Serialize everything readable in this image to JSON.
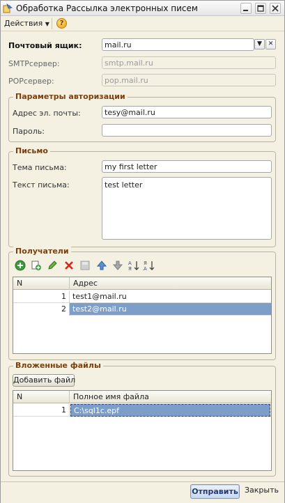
{
  "window": {
    "title": "Обработка  Рассылка электронных писем"
  },
  "toolbar": {
    "actions_label": "Действия",
    "help_label": "?"
  },
  "mailbox": {
    "label": "Почтовый ящик:",
    "value": "mail.ru",
    "smtp_label": "SMTPсервер:",
    "smtp_value": "smtp.mail.ru",
    "pop_label": "POPсервер:",
    "pop_value": "pop.mail.ru"
  },
  "auth": {
    "title": "Параметры авторизации",
    "email_label": "Адрес эл. почты:",
    "email_value": "tesy@mail.ru",
    "password_label": "Пароль:",
    "password_value": ""
  },
  "letter": {
    "title": "Письмо",
    "subject_label": "Тема письма:",
    "subject_value": "my first letter",
    "body_label": "Текст письма:",
    "body_value": "test letter"
  },
  "recipients": {
    "title": "Получатели",
    "columns": [
      "N",
      "Адрес"
    ],
    "rows": [
      {
        "n": "1",
        "address": "test1@mail.ru",
        "selected": false
      },
      {
        "n": "2",
        "address": "test2@mail.ru",
        "selected": true
      }
    ]
  },
  "attachments": {
    "title": "Вложенные файлы",
    "add_button": "Добавить файл",
    "columns": [
      "N",
      "Полное имя файла"
    ],
    "rows": [
      {
        "n": "1",
        "path": "C:\\sql1c.epf"
      }
    ]
  },
  "footer": {
    "send_label": "Отправить",
    "close_label": "Закрыть"
  },
  "colors": {
    "group_title": "#7a3f0a",
    "selection": "#7c9ec9"
  }
}
